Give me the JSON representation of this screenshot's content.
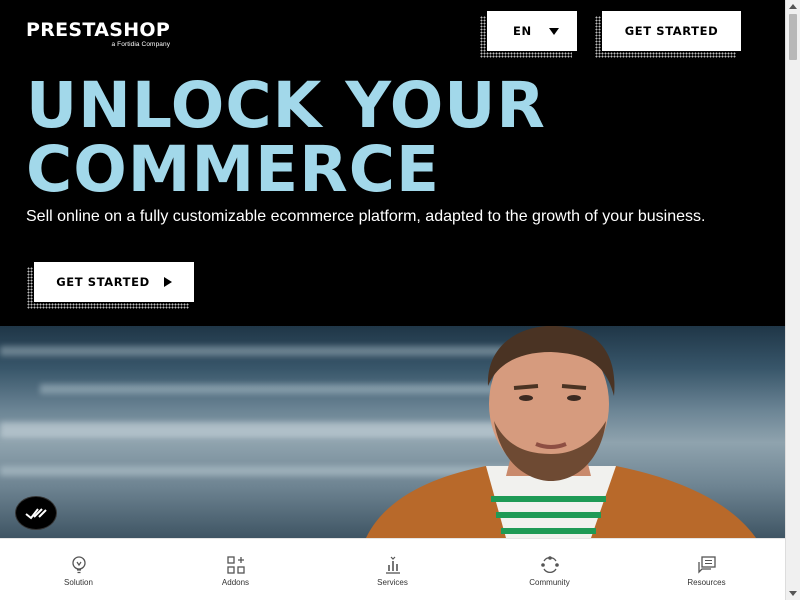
{
  "header": {
    "logo_text": "PRESTASHOP",
    "logo_subtext": "a Fortidia Company",
    "language_label": "EN",
    "get_started_label": "GET STARTED"
  },
  "hero": {
    "headline_line1": "UNLOCK YOUR",
    "headline_line2": "COMMERCE",
    "subtitle": "Sell online on a fully customizable ecommerce platform, adapted to the growth of your business.",
    "cta_label": "GET STARTED"
  },
  "bottom_nav": {
    "items": [
      {
        "label": "Solution",
        "icon": "lightbulb-icon"
      },
      {
        "label": "Addons",
        "icon": "addons-grid-icon"
      },
      {
        "label": "Services",
        "icon": "services-chart-icon"
      },
      {
        "label": "Community",
        "icon": "community-cycle-icon"
      },
      {
        "label": "Resources",
        "icon": "resources-chat-icon"
      }
    ]
  },
  "colors": {
    "headline": "#a2d8ea",
    "background": "#000000",
    "button_bg": "#ffffff"
  }
}
